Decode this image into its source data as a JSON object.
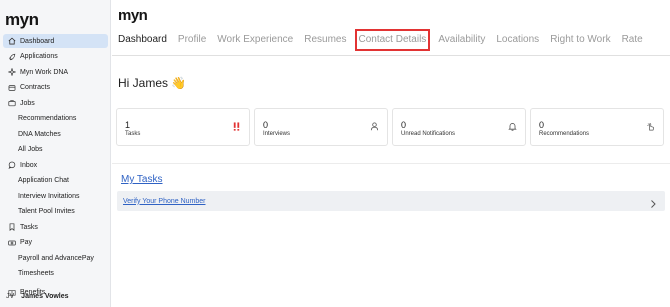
{
  "sidebar": {
    "logo": "myn",
    "items": [
      {
        "label": "Dashboard",
        "icon": "home-icon"
      },
      {
        "label": "Applications",
        "icon": "rocket-icon"
      },
      {
        "label": "Myn Work DNA",
        "icon": "sparkle-icon"
      },
      {
        "label": "Contracts",
        "icon": "contract-icon"
      },
      {
        "label": "Jobs",
        "icon": "briefcase-icon"
      },
      {
        "label": "Recommendations"
      },
      {
        "label": "DNA Matches"
      },
      {
        "label": "All Jobs"
      },
      {
        "label": "Inbox",
        "icon": "chat-icon"
      },
      {
        "label": "Application Chat"
      },
      {
        "label": "Interview Invitations"
      },
      {
        "label": "Talent Pool Invites"
      },
      {
        "label": "Tasks",
        "icon": "bookmark-icon"
      },
      {
        "label": "Pay",
        "icon": "money-icon"
      },
      {
        "label": "Payroll and AdvancePay"
      },
      {
        "label": "Timesheets"
      },
      {
        "label": "Benefits",
        "icon": "book-icon"
      }
    ],
    "user": {
      "initials": "JV",
      "name": "James Vowles"
    }
  },
  "main": {
    "logo": "myn",
    "tabs": [
      "Dashboard",
      "Profile",
      "Work Experience",
      "Resumes",
      "Contact Details",
      "Availability",
      "Locations",
      "Right to Work",
      "Rate"
    ],
    "active_tab": "Dashboard",
    "highlighted_tab": "Contact Details",
    "greeting": "Hi James 👋",
    "cards": [
      {
        "value": "1",
        "label": "Tasks",
        "icon": "alert-icon"
      },
      {
        "value": "0",
        "label": "Interviews",
        "icon": "person-icon"
      },
      {
        "value": "0",
        "label": "Unread Notifications",
        "icon": "bell-icon"
      },
      {
        "value": "0",
        "label": "Recommendations",
        "icon": "pointer-icon"
      }
    ],
    "tasks_title": "My Tasks",
    "tasks": [
      {
        "label": "Verify Your Phone Number"
      }
    ]
  },
  "colors": {
    "accent": "#2f62c4",
    "active_nav": "#d4e3f6",
    "highlight": "#e23333",
    "alert": "#e23333"
  }
}
